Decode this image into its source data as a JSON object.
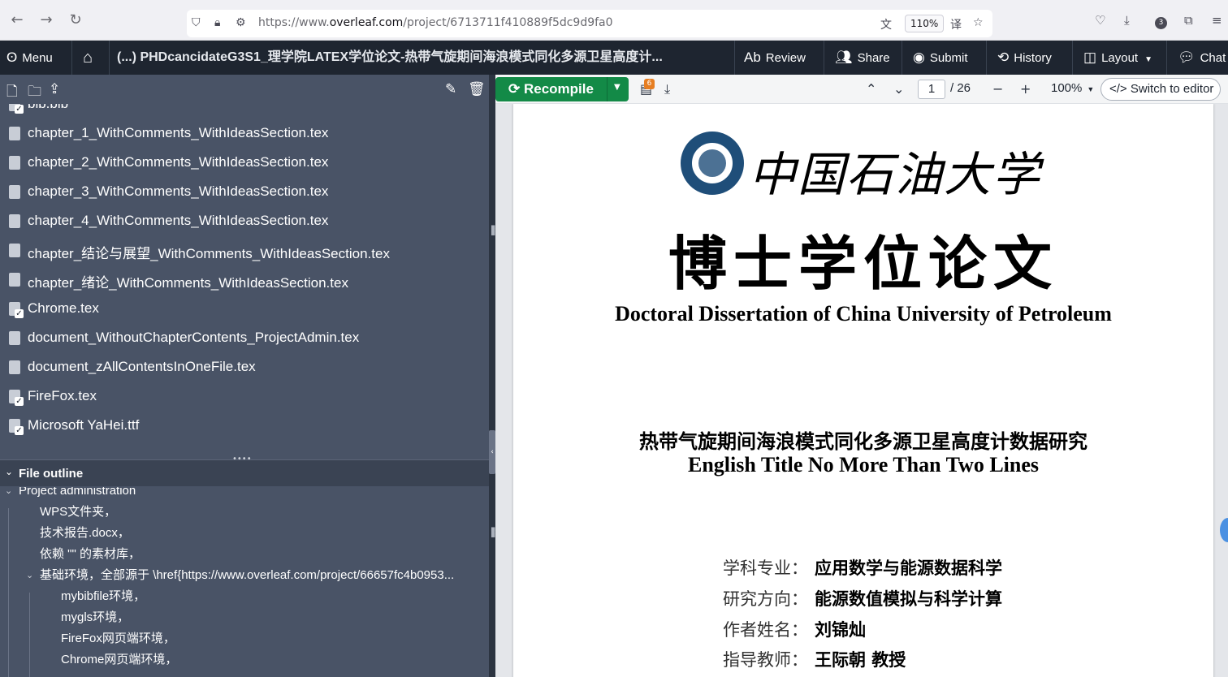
{
  "browser": {
    "url_prefix": "https://www.",
    "url_host": "overleaf.com",
    "url_path": "/project/6713711f410889f5dc9d9fa0",
    "zoom": "110%",
    "badge_count": "3"
  },
  "toolbar": {
    "menu_label": "Menu",
    "project_title": "(...) PHDcancidateG3S1_理学院LATEX学位论文-热带气旋期间海浪模式同化多源卫星高度计...",
    "review_label": "Review",
    "share_label": "Share",
    "submit_label": "Submit",
    "history_label": "History",
    "layout_label": "Layout",
    "chat_label": "Chat"
  },
  "files": [
    {
      "name": "bib.bib",
      "checked": true
    },
    {
      "name": "chapter_1_WithComments_WithIdeasSection.tex",
      "checked": false
    },
    {
      "name": "chapter_2_WithComments_WithIdeasSection.tex",
      "checked": false
    },
    {
      "name": "chapter_3_WithComments_WithIdeasSection.tex",
      "checked": false
    },
    {
      "name": "chapter_4_WithComments_WithIdeasSection.tex",
      "checked": false
    },
    {
      "name": "chapter_结论与展望_WithComments_WithIdeasSection.tex",
      "checked": false
    },
    {
      "name": "chapter_绪论_WithComments_WithIdeasSection.tex",
      "checked": false
    },
    {
      "name": "Chrome.tex",
      "checked": true
    },
    {
      "name": "document_WithoutChapterContents_ProjectAdmin.tex",
      "checked": false
    },
    {
      "name": "document_zAllContentsInOneFile.tex",
      "checked": false
    },
    {
      "name": "FireFox.tex",
      "checked": true
    },
    {
      "name": "Microsoft YaHei.ttf",
      "checked": true
    }
  ],
  "outline": {
    "header": "File outline",
    "items": [
      {
        "label": "Project administration",
        "level": 0,
        "expanded": true
      },
      {
        "label": "WPS文件夹，",
        "level": 1
      },
      {
        "label": "技术报告.docx，",
        "level": 1
      },
      {
        "label": "依赖 \"\" 的素材库，",
        "level": 1
      },
      {
        "label": "基础环境，全部源于 \\href{https://www.overleaf.com/project/66657fc4b0953...",
        "level": 1,
        "expanded": true
      },
      {
        "label": "mybibfile环境，",
        "level": 2
      },
      {
        "label": "mygls环境，",
        "level": 2
      },
      {
        "label": "FireFox网页端环境，",
        "level": 2
      },
      {
        "label": "Chrome网页端环境，",
        "level": 2
      }
    ]
  },
  "pdf_toolbar": {
    "recompile_label": "Recompile",
    "log_count": "6",
    "current_page": "1",
    "total_pages": "/ 26",
    "zoom": "100%",
    "switch_label": "Switch to editor"
  },
  "pdf": {
    "university_cn": "中国石油大学",
    "heading": "博士学位论文",
    "subheading": "Doctoral Dissertation of China University of Petroleum",
    "title_cn": "热带气旋期间海浪模式同化多源卫星高度计数据研究",
    "title_en": "English Title No More Than Two Lines",
    "info": [
      {
        "key": "学科专业：",
        "value": "应用数学与能源数据科学"
      },
      {
        "key": "研究方向：",
        "value": "能源数值模拟与科学计算"
      },
      {
        "key": "作者姓名：",
        "value": "刘锦灿"
      },
      {
        "key": "指导教师：",
        "value": "王际朝 教授"
      }
    ]
  }
}
